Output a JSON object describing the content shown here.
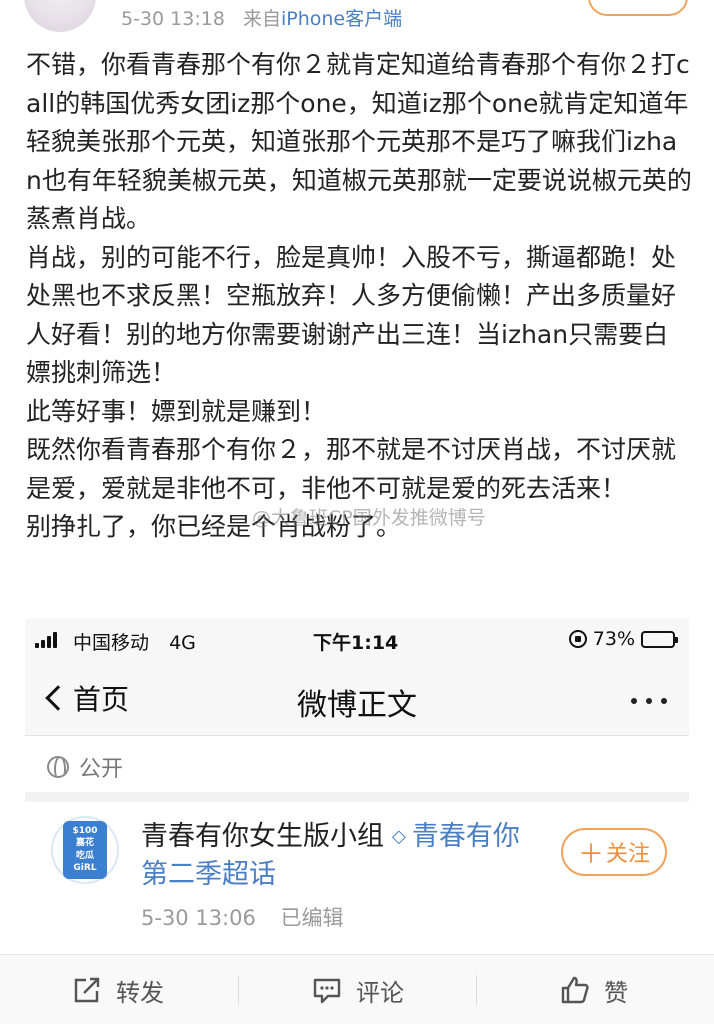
{
  "post_meta": {
    "timestamp": "5-30 13:18",
    "source_prefix": "来自",
    "source_client": "iPhone客户端"
  },
  "post_body": {
    "paragraphs": [
      "不错，你看青春那个有你２就肯定知道给青春那个有你２打call的韩国优秀女团iz那个one，知道iz那个one就肯定知道年轻貌美张那个元英，知道张那个元英那不是巧了嘛我们izhan也有年轻貌美椒元英，知道椒元英那就一定要说说椒元英的蒸煮肖战。",
      "肖战，别的可能不行，脸是真帅！入股不亏，撕逼都跪！处处黑也不求反黑！空瓶放弃！人多方便偷懒！产出多质量好人好看！别的地方你需要谢谢产出三连！当izhan只需要白嫖挑刺筛选！",
      "此等好事！嫖到就是赚到！",
      "既然你看青春那个有你２，那不就是不讨厌肖战，不讨厌就是爱，爱就是非他不可，非他不可就是爱的死去活来！",
      "别挣扎了，你已经是个肖战粉了。"
    ]
  },
  "watermark": "@大鲁班CP国外发推微博号",
  "embedded": {
    "status_bar": {
      "carrier": "中国移动",
      "network": "4G",
      "time": "下午1:14",
      "battery": "73%",
      "battery_level": 0.73
    },
    "nav": {
      "back_label": "首页",
      "title": "微博正文"
    },
    "visibility": "公开",
    "group": {
      "name": "青春有你女生版小组",
      "topic": "青春有你第二季超话",
      "logo_lines": [
        "$100",
        "嘉花",
        "吃瓜",
        "GiRL"
      ],
      "time": "5-30 13:06",
      "edited": "已编辑",
      "follow_label": "关注",
      "follow_plus": "＋"
    }
  },
  "toolbar": {
    "repost_label": "转发",
    "comment_label": "评论",
    "like_label": "赞"
  }
}
